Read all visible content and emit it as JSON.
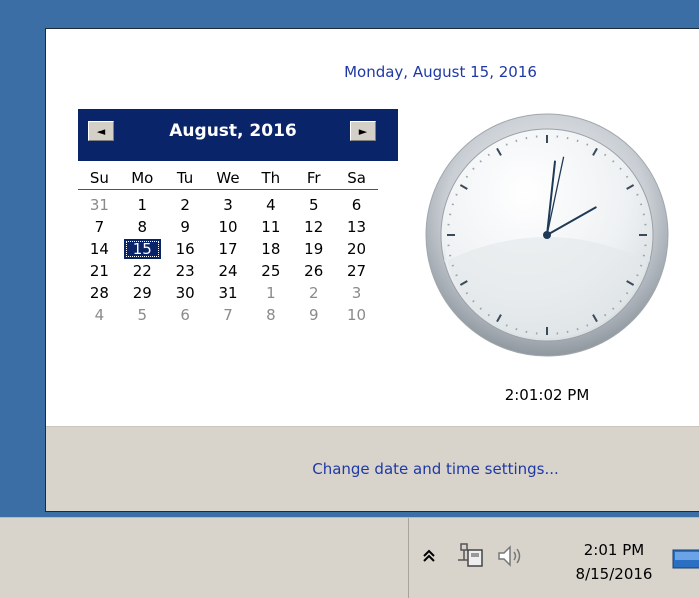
{
  "flyout": {
    "date_title": "Monday, August 15, 2016",
    "settings_link": "Change date and time settings...",
    "clock_time": "2:01:02 PM"
  },
  "calendar": {
    "month_label": "August, 2016",
    "prev_symbol": "◄",
    "next_symbol": "►",
    "weekdays": [
      "Su",
      "Mo",
      "Tu",
      "We",
      "Th",
      "Fr",
      "Sa"
    ],
    "weeks": [
      [
        "31",
        "1",
        "2",
        "3",
        "4",
        "5",
        "6"
      ],
      [
        "7",
        "8",
        "9",
        "10",
        "11",
        "12",
        "13"
      ],
      [
        "14",
        "15",
        "16",
        "17",
        "18",
        "19",
        "20"
      ],
      [
        "21",
        "22",
        "23",
        "24",
        "25",
        "26",
        "27"
      ],
      [
        "28",
        "29",
        "30",
        "31",
        "1",
        "2",
        "3"
      ],
      [
        "4",
        "5",
        "6",
        "7",
        "8",
        "9",
        "10"
      ]
    ],
    "selected_day": "15"
  },
  "analog_clock": {
    "hours": 2,
    "minutes": 1,
    "seconds": 2
  },
  "taskbar": {
    "time": "2:01 PM",
    "date": "8/15/2016",
    "show_hidden_icon": "chevron-up-icon",
    "network_icon": "network-icon",
    "volume_icon": "speaker-icon"
  },
  "colors": {
    "desktop": "#3a6ea5",
    "calendar_header": "#0a246a",
    "link": "#1e39a5"
  }
}
